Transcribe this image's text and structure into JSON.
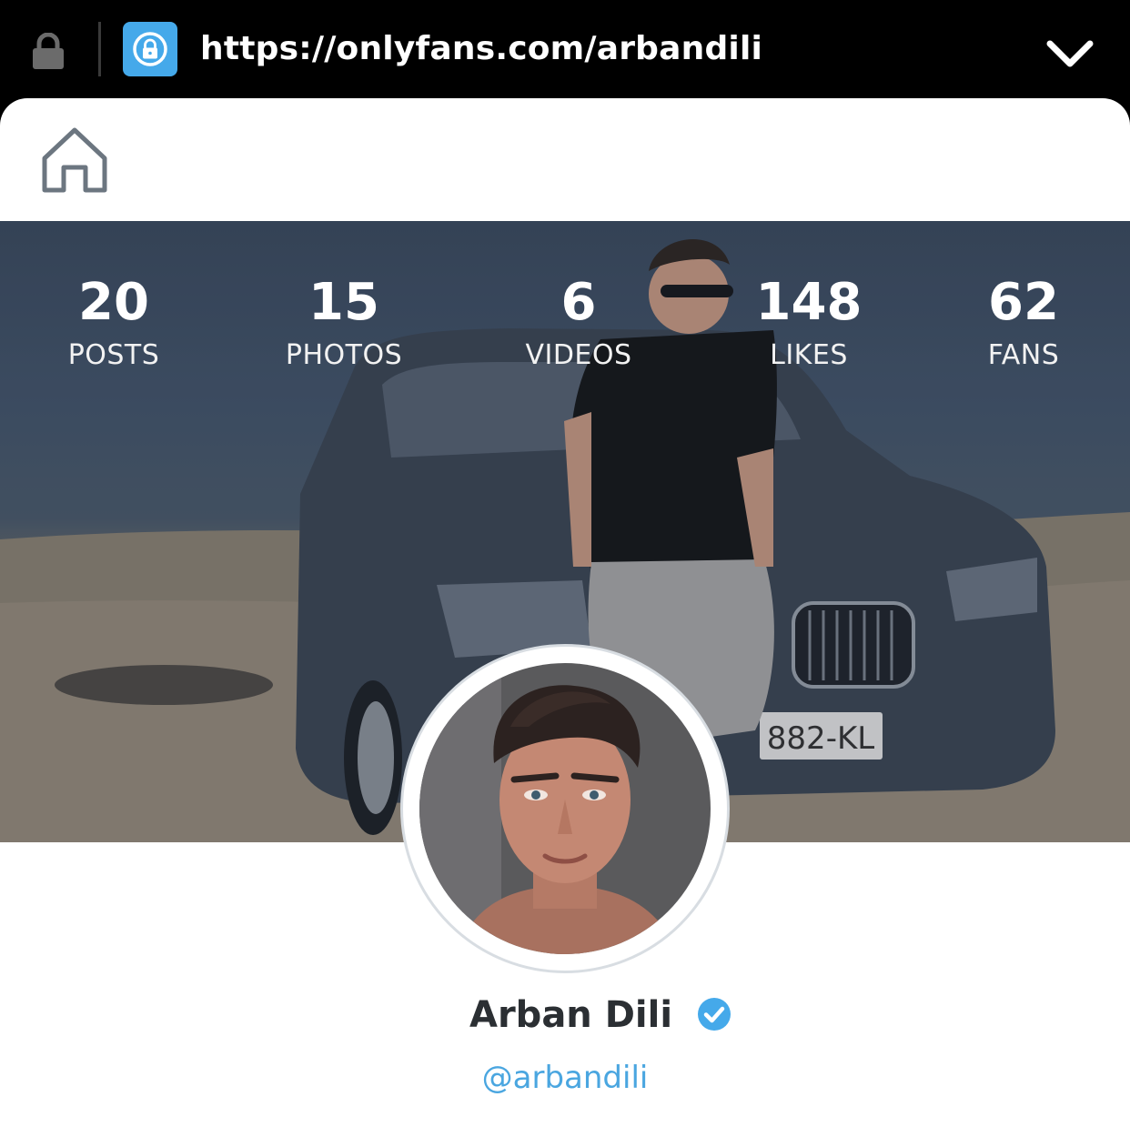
{
  "browser": {
    "url": "https://onlyfans.com/arbandili",
    "lock_icon": "lock-icon",
    "app_icon": "lock-circle-icon",
    "dropdown_icon": "chevron-down-icon"
  },
  "header": {
    "home_icon": "home-icon"
  },
  "profile": {
    "stats": [
      {
        "value": "20",
        "label": "POSTS"
      },
      {
        "value": "15",
        "label": "PHOTOS"
      },
      {
        "value": "6",
        "label": "VIDEOS"
      },
      {
        "value": "148",
        "label": "LIKES"
      },
      {
        "value": "62",
        "label": "FANS"
      }
    ],
    "name": "Arban Dili",
    "handle": "@arbandili",
    "verified_icon": "verified-check-icon"
  },
  "colors": {
    "accent": "#45a9ea",
    "handle": "#4aa6e0",
    "name": "#2b2f33"
  }
}
